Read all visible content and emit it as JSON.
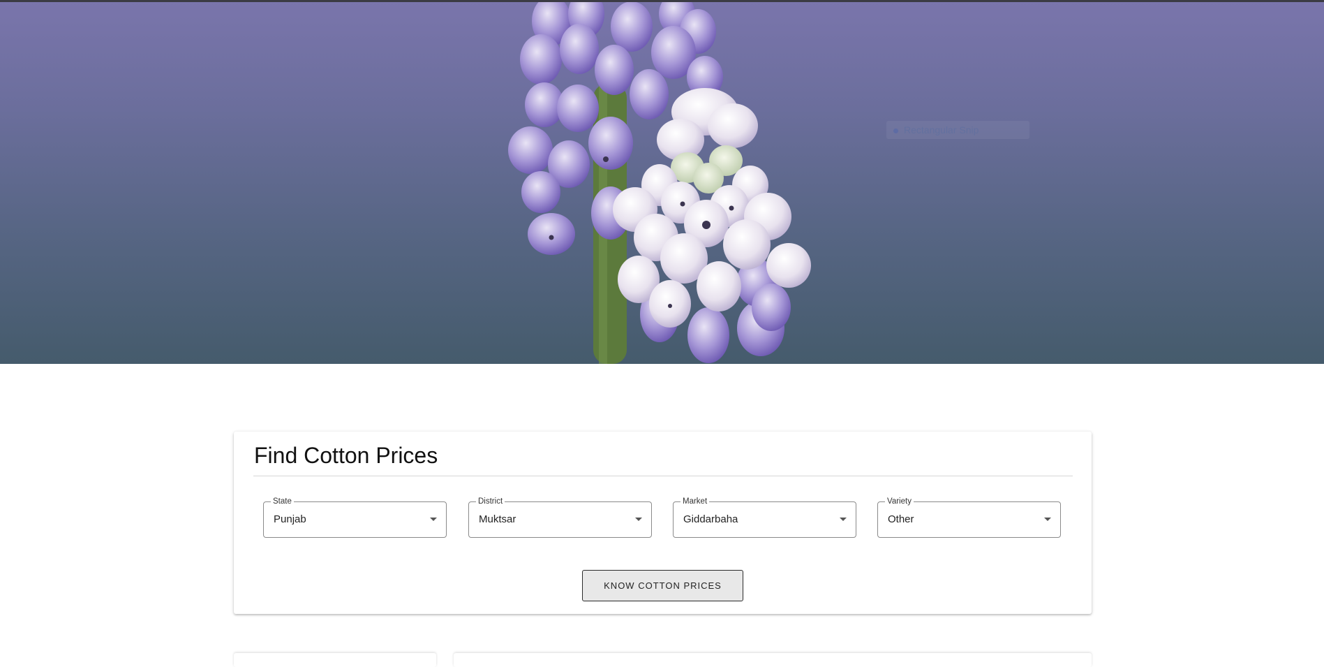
{
  "hero": {
    "image_subject": "grape-hyacinth-flower-icon",
    "watermark_text": "Rectangular Snip"
  },
  "colors": {
    "hero_top": "#7a75ac",
    "hero_bottom": "#455b6c",
    "button_bg": "#e8e8e8"
  },
  "card": {
    "title": "Find Cotton Prices",
    "fields": [
      {
        "label": "State",
        "value": "Punjab"
      },
      {
        "label": "District",
        "value": "Muktsar"
      },
      {
        "label": "Market",
        "value": "Giddarbaha"
      },
      {
        "label": "Variety",
        "value": "Other"
      }
    ],
    "button_label": "KNOW COTTON PRICES"
  }
}
